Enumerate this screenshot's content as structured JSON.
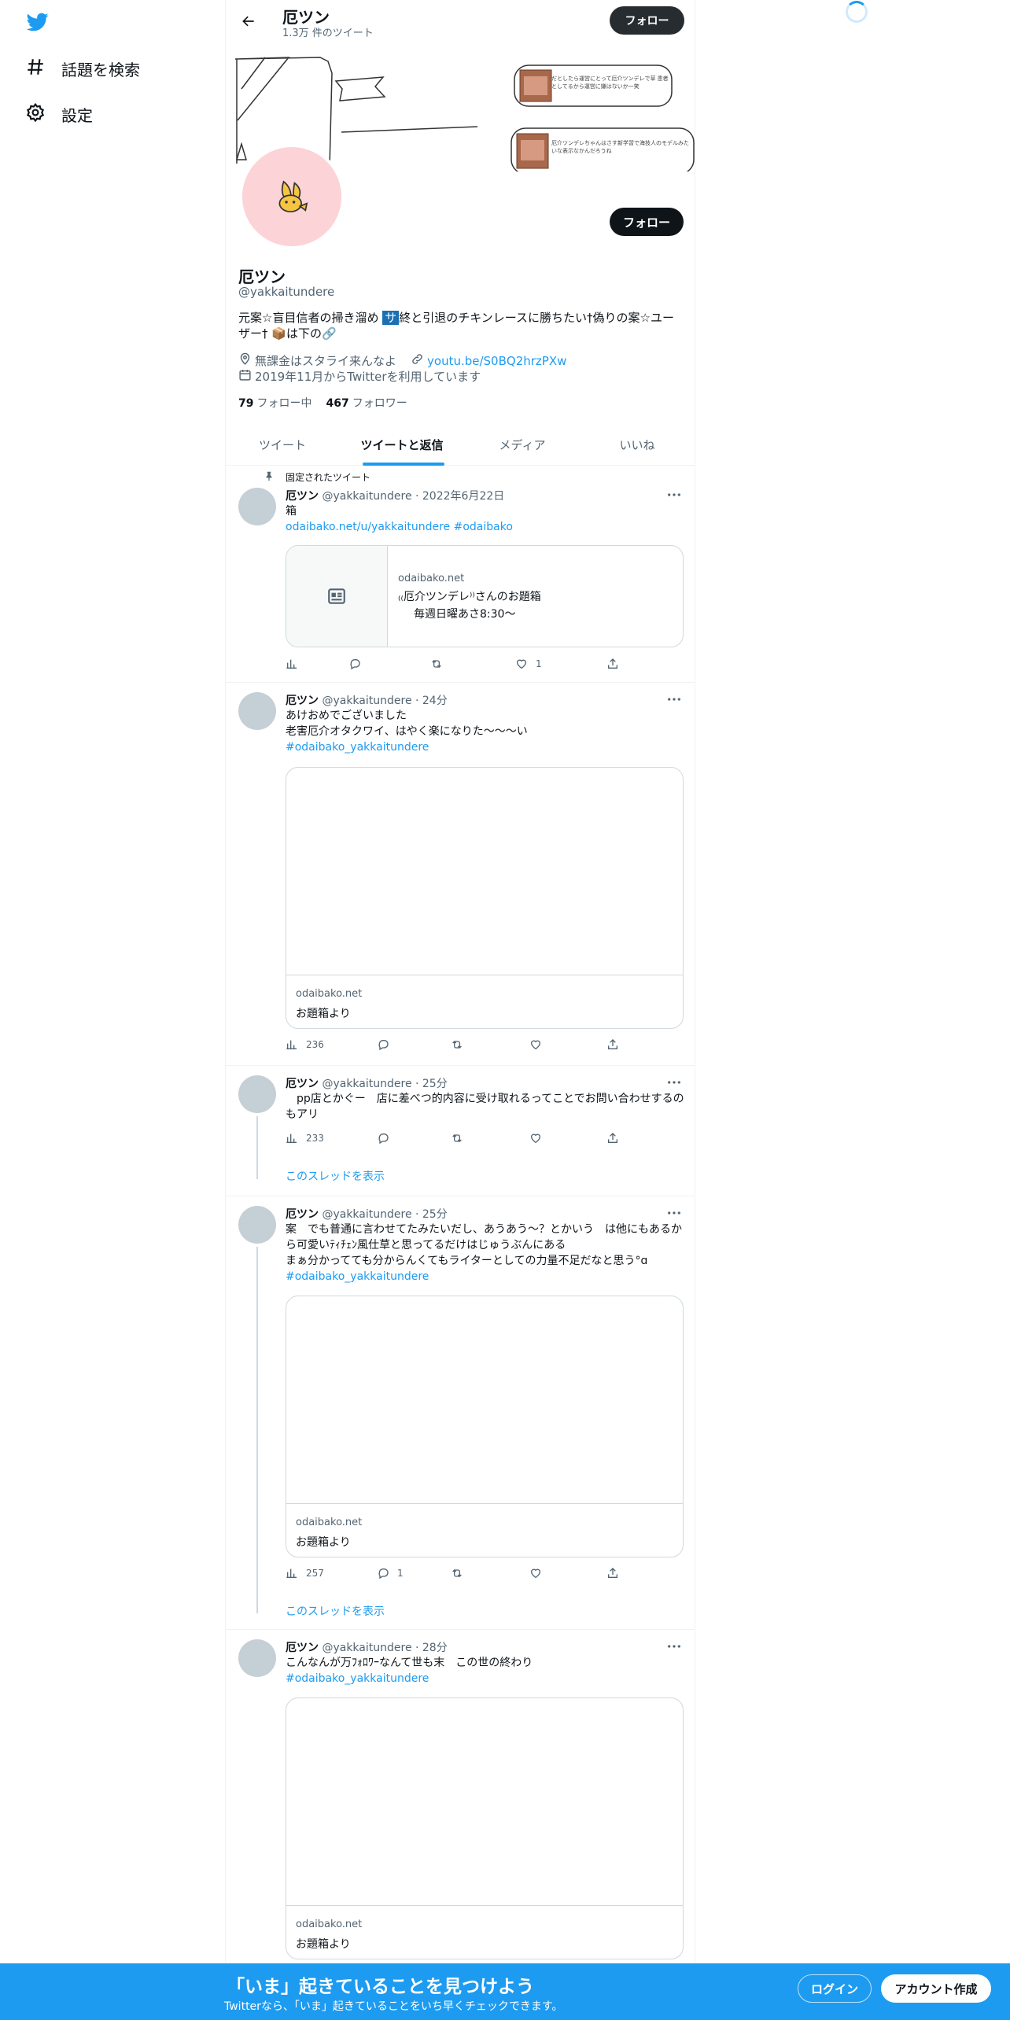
{
  "sidebar": {
    "items": [
      {
        "label": "話題を検索",
        "icon": "hashtag-icon"
      },
      {
        "label": "設定",
        "icon": "gear-icon"
      }
    ]
  },
  "header": {
    "title": "厄ツン",
    "tweet_count": "1.3万 件のツイート",
    "follow_label": "フォロー"
  },
  "banner": {
    "note1": "だとしたら運営にとって厄介ツンデレで草 患者としてるから運営に嫌はないか一笑",
    "note2": "厄介ツンデレちゃんはさす新学習で海技人のモデルみたいな表示なかんだろうね"
  },
  "profile": {
    "name": "厄ツン",
    "handle": "@yakkaitundere",
    "follow_button": "フォロー",
    "bio_pre": "元案☆盲目信者の掃き溜め ",
    "bio_badge": "サ",
    "bio_post": "終と引退のチキンレースに勝ちたい†偽りの案☆ユーザー† 📦は下の🔗",
    "location": "無課金はスタライ来んなよ",
    "link": "youtu.be/S0BQ2hrzPXw",
    "joined": "2019年11月からTwitterを利用しています",
    "following_count": "79",
    "following_label": "フォロー中",
    "followers_count": "467",
    "followers_label": "フォロワー"
  },
  "tabs": [
    "ツイート",
    "ツイートと返信",
    "メディア",
    "いいね"
  ],
  "tweets": [
    {
      "pinned_label": "固定されたツイート",
      "name": "厄ツン",
      "meta": "@yakkaitundere · 2022年6月22日",
      "text": "箱",
      "link_line": "odaibako.net/u/yakkaitundere #odaibako",
      "card_domain": "odaibako.net",
      "card_title": "₍₍厄介ツンデレ⁾⁾さんのお題箱",
      "card_desc": "毎週日曜あさ8:30〜",
      "views": "",
      "replies": "",
      "likes": "1"
    },
    {
      "name": "厄ツン",
      "meta": "@yakkaitundere · 24分",
      "text": "あけおめでございました\n老害厄介オタクワイ、はやく楽になりた〜〜〜い",
      "hashtag": "#odaibako_yakkaitundere",
      "card_domain": "odaibako.net",
      "card_title": "お題箱より",
      "views": "236",
      "replies": "",
      "likes": ""
    },
    {
      "name": "厄ツン",
      "meta": "@yakkaitundere · 25分",
      "text": "　pp店とかぐー　店に差べつ的内容に受け取れるってことでお問い合わせするのもアリ",
      "views": "233",
      "replies": "",
      "likes": "",
      "thread_label": "このスレッドを表示"
    },
    {
      "name": "厄ツン",
      "meta": "@yakkaitundere · 25分",
      "text": "案　でも普通に言わせてたみたいだし、あうあう〜？とかいう　は他にもあるから可愛いﾃｨﾁｪﾝ風仕草と思ってるだけはじゅうぶんにある\nまぁ分かってても分からんくてもライターとしての力量不足だなと思う°ɑ",
      "hashtag": "#odaibako_yakkaitundere",
      "card_domain": "odaibako.net",
      "card_title": "お題箱より",
      "views": "257",
      "replies": "1",
      "likes": "",
      "thread_label": "このスレッドを表示"
    },
    {
      "name": "厄ツン",
      "meta": "@yakkaitundere · 28分",
      "text": "こんなんが万ﾌｫﾛﾜｰなんて世も末　この世の終わり",
      "hashtag": "#odaibako_yakkaitundere",
      "card_domain": "odaibako.net",
      "card_title": "お題箱より"
    }
  ],
  "bottom_bar": {
    "title": "「いま」起きていることを見つけよう",
    "subtitle": "Twitterなら、「いま」起きていることをいち早くチェックできます。",
    "login_label": "ログイン",
    "signup_label": "アカウント作成"
  },
  "colors": {
    "accent": "#1d9bf0",
    "text": "#0f1419",
    "secondary": "#536471",
    "avatar_bg": "#fcd3d6"
  }
}
